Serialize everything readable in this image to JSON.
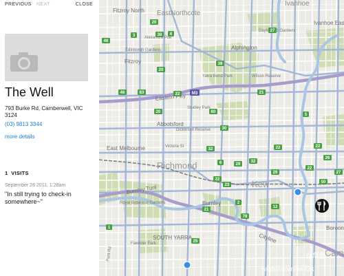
{
  "nav": {
    "previous": "PREVIOUS",
    "next": "NEXT",
    "close": "CLOSE"
  },
  "place": {
    "name": "The Well",
    "address": "793 Burke Rd, Camberwell, VIC 3124",
    "phone": "(03) 9813 3344",
    "more_details": "more details"
  },
  "visits": {
    "count": "1",
    "label": "VISITS",
    "entries": [
      {
        "date": "September 28 2011, 1:28am",
        "text": "\"In still trying to check-in somewhere~\""
      }
    ]
  },
  "map": {
    "labels": {
      "fitzroy_north": "Fitzroy North",
      "northcote": "Northcote",
      "east": "East",
      "ivanhoe": "Ivanhoe",
      "ivanhoe_east": "Ivanhoe East",
      "alphington": "Alphington",
      "fitzroy": "Fitzroy",
      "abbotsford": "Abbotsford",
      "eastern_fwy": "Eastern Fwy",
      "east_melbourne": "East Melbourne",
      "richmond": "Richmond",
      "burnley": "Burnley",
      "burnley_tunl": "Burnley Tunl",
      "south_yarra": "SOUTH YARRA",
      "cityline": "Cityline",
      "kew": "Kew",
      "boroondara": "Boroon",
      "camberwell": "Camb",
      "edinburgh_gardens": "Edinburgh Gardens",
      "yarra_bend_park": "Yarra Bend Park",
      "studley_park": "Studley Park",
      "dickinson_reserve": "Dickinson Reserve",
      "royal_botanical_gardens": "Royal Botanical Gardens",
      "fawkner_park": "Fawkner Park",
      "daylesford_gardens": "Daylesford Gardens",
      "wilson_reserve": "Wilson Reserve",
      "victoria_st": "Victoria St",
      "alexandra_pde": "Alexandra Pde",
      "punt_rd": "Punt Rd"
    },
    "shields": [
      "38",
      "46",
      "3",
      "20",
      "38",
      "6",
      "60",
      "46",
      "83",
      "20",
      "22",
      "21",
      "27",
      "20",
      "32",
      "5",
      "30",
      "29",
      "22",
      "22",
      "26",
      "2",
      "22",
      "1",
      "6",
      "29",
      "22",
      "25",
      "32",
      "21",
      "23",
      "50",
      "27",
      "12",
      "78"
    ],
    "freeway_shield": "M3"
  },
  "watermark": {
    "handle": "@华野",
    "site": "weibo.com/wnf3k"
  },
  "colors": {
    "link": "#1e7fd6",
    "park": "#cfdcb4",
    "freeway": "#a89ccd",
    "river": "#a9c6e3",
    "pin": "#3a8ee6",
    "shield": "#4aa047"
  }
}
